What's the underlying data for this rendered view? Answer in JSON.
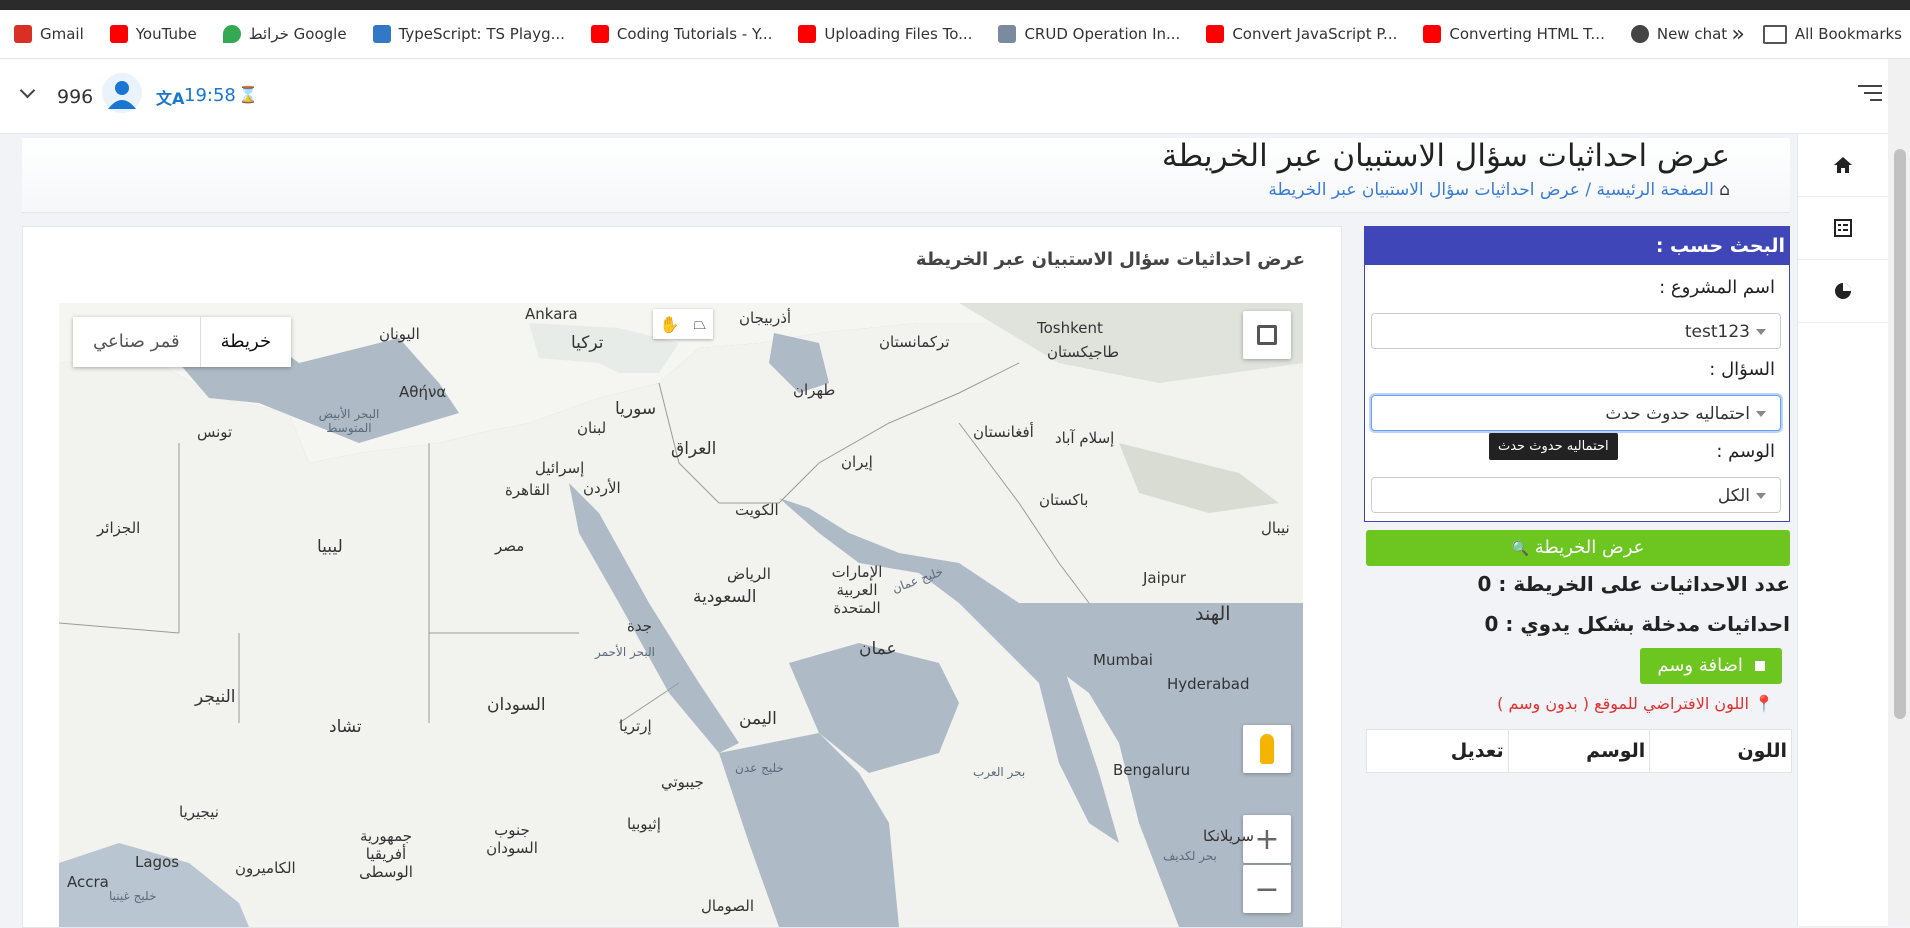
{
  "bookmarks": {
    "items": [
      {
        "label": "Gmail",
        "icon": "gmail-icon",
        "color": "#d93025"
      },
      {
        "label": "YouTube",
        "icon": "youtube-icon",
        "color": "#ff0000"
      },
      {
        "label": "خرائط Google",
        "icon": "maps-pin-icon",
        "color": "#34a853"
      },
      {
        "label": "TypeScript: TS Playg...",
        "icon": "typescript-icon",
        "color": "#3178c6"
      },
      {
        "label": "Coding Tutorials - Y...",
        "icon": "youtube-icon",
        "color": "#ff0000"
      },
      {
        "label": "Uploading Files To...",
        "icon": "youtube-icon",
        "color": "#ff0000"
      },
      {
        "label": "CRUD Operation In...",
        "icon": "site-icon",
        "color": "#7a8aa0"
      },
      {
        "label": "Convert JavaScript P...",
        "icon": "youtube-icon",
        "color": "#ff0000"
      },
      {
        "label": "Converting HTML T...",
        "icon": "youtube-icon",
        "color": "#ff0000"
      },
      {
        "label": "New chat",
        "icon": "openai-icon",
        "color": "#444444"
      }
    ],
    "more": "»",
    "all_bookmarks": "All Bookmarks"
  },
  "topbar": {
    "count": "996",
    "time": "19:58"
  },
  "header": {
    "title": "عرض احداثيات سؤال الاستبيان عبر الخريطة",
    "crumb_home": "الصفحة الرئيسية",
    "crumb_sep": "/",
    "crumb_current": "عرض احداثيات سؤال الاستبيان عبر الخريطة"
  },
  "map_card": {
    "title": "عرض احداثيات سؤال الاستبيان عبر الخريطة"
  },
  "map": {
    "type_map": "خريطة",
    "type_satellite": "قمر صناعي",
    "zoom_in": "+",
    "zoom_out": "−",
    "labels": [
      {
        "t": "تركيا"
      },
      {
        "t": "اليونان"
      },
      {
        "t": "أذربيجان"
      },
      {
        "t": "تركمانستان"
      },
      {
        "t": "Ankara"
      },
      {
        "t": "Toshkent"
      },
      {
        "t": "طاجيكستان"
      },
      {
        "t": "سوريا"
      },
      {
        "t": "لبنان"
      },
      {
        "t": "طهران"
      },
      {
        "t": "العراق"
      },
      {
        "t": "إيران"
      },
      {
        "t": "أفغانستان"
      },
      {
        "t": "إسلام آباد"
      },
      {
        "t": "إسرائيل"
      },
      {
        "t": "الأردن"
      },
      {
        "t": "القاهرة"
      },
      {
        "t": "الكويت"
      },
      {
        "t": "باكستان"
      },
      {
        "t": "الجزائر"
      },
      {
        "t": "ليبيا"
      },
      {
        "t": "مصر"
      },
      {
        "t": "تونس"
      },
      {
        "t": "الرياض"
      },
      {
        "t": "السعودية"
      },
      {
        "t": "الإمارات العربية المتحدة"
      },
      {
        "t": "Jaipur"
      },
      {
        "t": "الهند"
      },
      {
        "t": "جدة"
      },
      {
        "t": "عمان"
      },
      {
        "t": "Mumbai"
      },
      {
        "t": "Hyderabad"
      },
      {
        "t": "النيجر"
      },
      {
        "t": "تشاد"
      },
      {
        "t": "السودان"
      },
      {
        "t": "اليمن"
      },
      {
        "t": "إرتريا"
      },
      {
        "t": "جيبوتي"
      },
      {
        "t": "Bengaluru"
      },
      {
        "t": "نيجيريا"
      },
      {
        "t": "إثيوبيا"
      },
      {
        "t": "جمهورية أفريقيا الوسطى"
      },
      {
        "t": "جنوب السودان"
      },
      {
        "t": "الصومال"
      },
      {
        "t": "Lagos"
      },
      {
        "t": "Accra"
      },
      {
        "t": "الكاميرون"
      },
      {
        "t": "سريلانكا"
      },
      {
        "t": "نيبال"
      },
      {
        "t": "Αθήνα"
      },
      {
        "t": "البحر الأبيض المتوسط"
      },
      {
        "t": "البحر الأحمر"
      },
      {
        "t": "خليج عدن"
      },
      {
        "t": "بحر العرب"
      },
      {
        "t": "خليج عمان"
      },
      {
        "t": "بحر لكديف"
      },
      {
        "t": "خليج غينيا"
      }
    ]
  },
  "filter": {
    "header": "البحث حسب :",
    "project_label": "اسم المشروع :",
    "project_value": "test123",
    "question_label": "السؤال :",
    "question_value": "احتماليه حدوث حدث",
    "tooltip": "احتماليه حدوث حدث",
    "tag_label": "الوسم :",
    "tag_value": "الكل"
  },
  "actions": {
    "show_map": "عرض الخريطة",
    "coords_count_label": "عدد الاحداثيات على الخريطة :",
    "coords_count": "0",
    "manual_label": "احداثيات مدخلة بشكل يدوي :",
    "manual_count": "0",
    "add_tag": "اضافة وسم",
    "default_color_note": "اللون الافتراضي للموقع ( بدون وسم )"
  },
  "table": {
    "col_color": "اللون",
    "col_tag": "الوسم",
    "col_edit": "تعديل"
  },
  "colors": {
    "primary": "#3f46b7",
    "success": "#6cc61f",
    "link": "#3a7bd5",
    "danger": "#e03030"
  }
}
